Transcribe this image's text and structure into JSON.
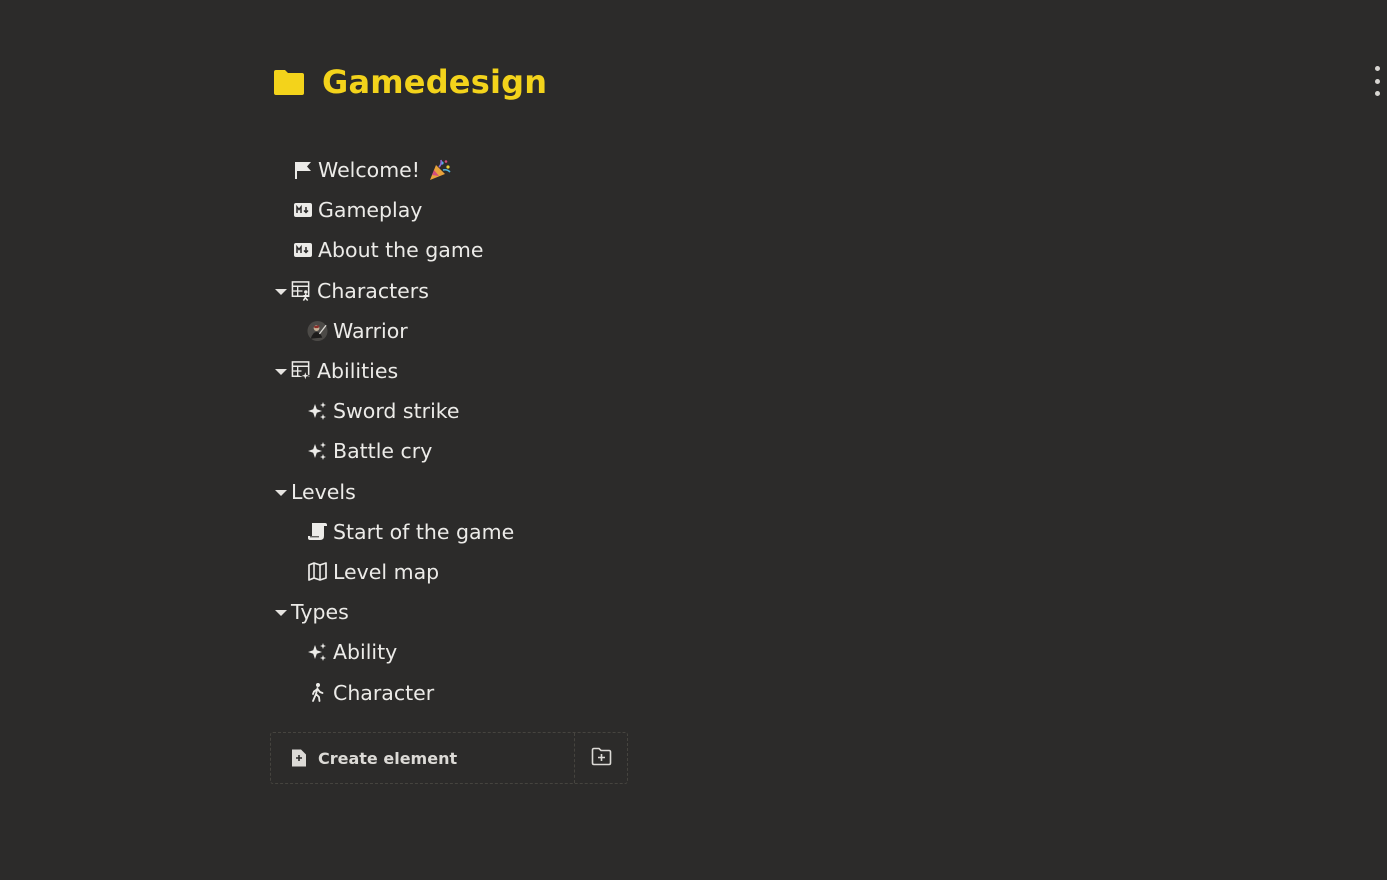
{
  "header": {
    "title": "Gamedesign",
    "icon": "folder-icon",
    "accent_color": "#f3d31b"
  },
  "tree": {
    "items": [
      {
        "label": "Welcome!",
        "icon": "flag-icon",
        "trailing_icon": "party-popper-icon"
      },
      {
        "label": "Gameplay",
        "icon": "markdown-icon"
      },
      {
        "label": "About the game",
        "icon": "markdown-icon"
      },
      {
        "label": "Characters",
        "icon": "character-table-icon",
        "expanded": true,
        "children": [
          {
            "label": "Warrior",
            "icon": "warrior-avatar-icon"
          }
        ]
      },
      {
        "label": "Abilities",
        "icon": "ability-table-icon",
        "expanded": true,
        "children": [
          {
            "label": "Sword strike",
            "icon": "sparkles-icon"
          },
          {
            "label": "Battle cry",
            "icon": "sparkles-icon"
          }
        ]
      },
      {
        "label": "Levels",
        "icon": "",
        "expanded": true,
        "children": [
          {
            "label": "Start of the game",
            "icon": "scroll-icon"
          },
          {
            "label": "Level map",
            "icon": "map-icon"
          }
        ]
      },
      {
        "label": "Types",
        "icon": "",
        "expanded": true,
        "children": [
          {
            "label": "Ability",
            "icon": "sparkles-icon"
          },
          {
            "label": "Character",
            "icon": "walking-person-icon"
          }
        ]
      }
    ]
  },
  "footer": {
    "create_label": "Create element",
    "create_icon": "file-plus-icon",
    "folder_icon": "folder-plus-icon"
  }
}
